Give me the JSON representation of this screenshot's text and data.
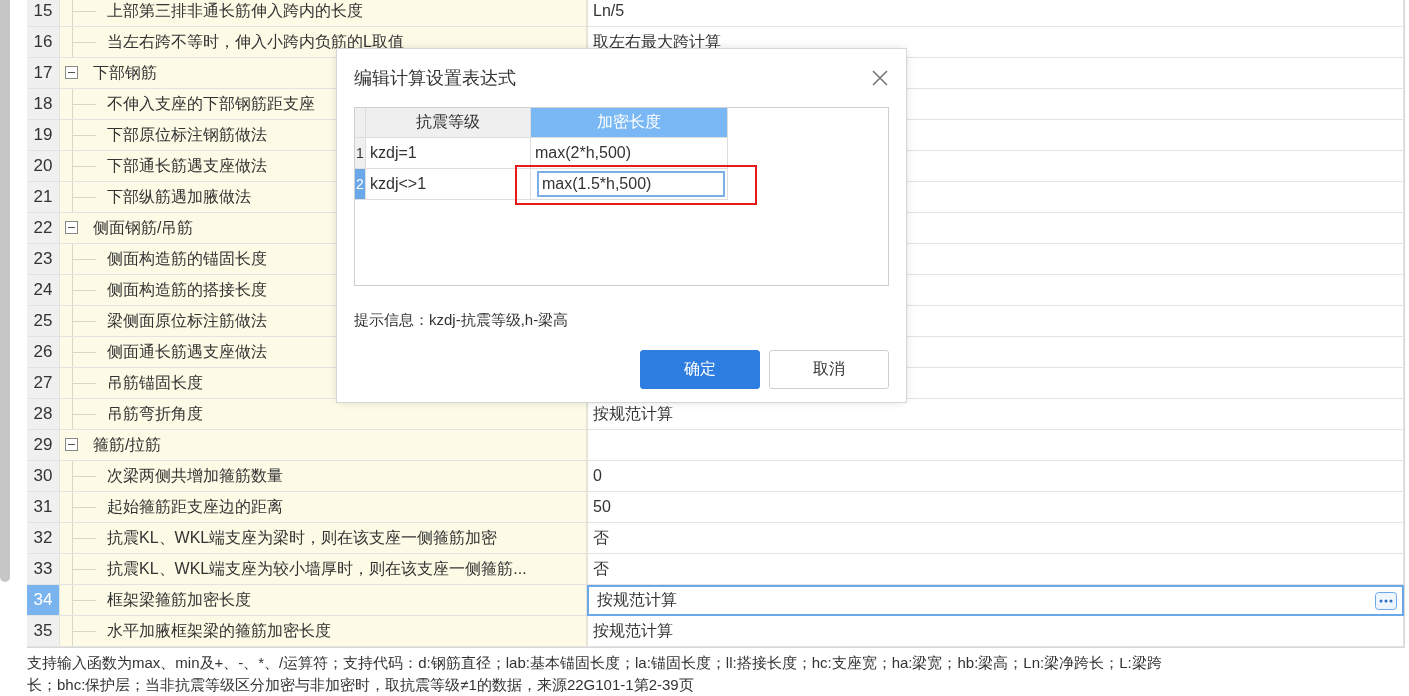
{
  "tree_table": {
    "rows": [
      {
        "number": "15",
        "kind": "item",
        "name": "上部第三排非通长筋伸入跨内的长度",
        "value": "Ln/5",
        "selected": false
      },
      {
        "number": "16",
        "kind": "item",
        "name": "当左右跨不等时，伸入小跨内负筋的L取值",
        "value": "取左右最大跨计算",
        "selected": false
      },
      {
        "number": "17",
        "kind": "group",
        "name": "下部钢筋",
        "expanded": true,
        "selected": false
      },
      {
        "number": "18",
        "kind": "item",
        "name": "不伸入支座的下部钢筋距支座",
        "selected": false
      },
      {
        "number": "19",
        "kind": "item",
        "name": "下部原位标注钢筋做法",
        "selected": false
      },
      {
        "number": "20",
        "kind": "item",
        "name": "下部通长筋遇支座做法",
        "selected": false
      },
      {
        "number": "21",
        "kind": "item",
        "name": "下部纵筋遇加腋做法",
        "selected": false
      },
      {
        "number": "22",
        "kind": "group",
        "name": "侧面钢筋/吊筋",
        "expanded": true,
        "selected": false
      },
      {
        "number": "23",
        "kind": "item",
        "name": "侧面构造筋的锚固长度",
        "selected": false
      },
      {
        "number": "24",
        "kind": "item",
        "name": "侧面构造筋的搭接长度",
        "selected": false
      },
      {
        "number": "25",
        "kind": "item",
        "name": "梁侧面原位标注筋做法",
        "selected": false
      },
      {
        "number": "26",
        "kind": "item",
        "name": "侧面通长筋遇支座做法",
        "selected": false
      },
      {
        "number": "27",
        "kind": "item",
        "name": "吊筋锚固长度",
        "selected": false
      },
      {
        "number": "28",
        "kind": "item",
        "name": "吊筋弯折角度",
        "value": "按规范计算",
        "selected": false
      },
      {
        "number": "29",
        "kind": "group",
        "name": "箍筋/拉筋",
        "expanded": true,
        "selected": false
      },
      {
        "number": "30",
        "kind": "item",
        "name": "次梁两侧共增加箍筋数量",
        "value": "0",
        "selected": false
      },
      {
        "number": "31",
        "kind": "item",
        "name": "起始箍筋距支座边的距离",
        "value": "50",
        "selected": false
      },
      {
        "number": "32",
        "kind": "item",
        "name": "抗震KL、WKL端支座为梁时，则在该支座一侧箍筋加密",
        "value": "否",
        "selected": false
      },
      {
        "number": "33",
        "kind": "item",
        "name": "抗震KL、WKL端支座为较小墙厚时，则在该支座一侧箍筋...",
        "value": "否",
        "selected": false
      },
      {
        "number": "34",
        "kind": "item",
        "name": "框架梁箍筋加密长度",
        "value": "按规范计算",
        "selected": true
      },
      {
        "number": "35",
        "kind": "item",
        "name": "水平加腋框架梁的箍筋加密长度",
        "value": "按规范计算",
        "selected": false
      }
    ]
  },
  "dialog": {
    "title": "编辑计算设置表达式",
    "columns": [
      {
        "label": "抗震等级",
        "selected": false
      },
      {
        "label": "加密长度",
        "selected": true
      }
    ],
    "rows": [
      {
        "number": "1",
        "condition": "kzdj=1",
        "length": "max(2*h,500)",
        "selected": false,
        "highlighted": false
      },
      {
        "number": "2",
        "condition": "kzdj<>1",
        "length": "max(1.5*h,500)",
        "selected": true,
        "highlighted": true
      }
    ],
    "hint": "提示信息：kzdj-抗震等级,h-梁高",
    "buttons": [
      {
        "label": "确定",
        "kind": "primary"
      },
      {
        "label": "取消",
        "kind": "secondary"
      }
    ]
  },
  "note_lines": [
    "支持输入函数为max、min及+、-、*、/运算符；支持代码：d:钢筋直径；lab:基本锚固长度；la:锚固长度；ll:搭接长度；hc:支座宽；ha:梁宽；hb:梁高；Ln:梁净跨长；L:梁跨",
    "长；bhc:保护层；当非抗震等级区分加密与非加密时，取抗震等级≠1的数据，来源22G101-1第2-39页"
  ]
}
